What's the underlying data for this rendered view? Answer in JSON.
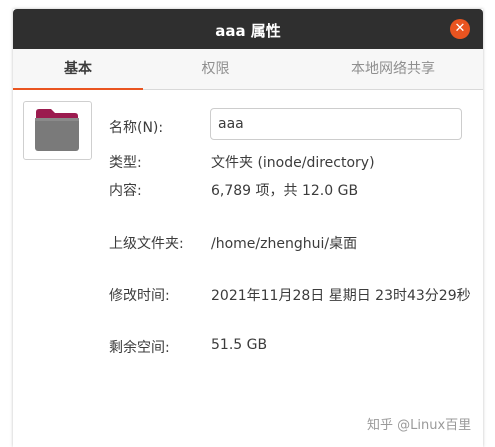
{
  "window": {
    "title": "aaa 属性"
  },
  "tabs": [
    {
      "label": "基本",
      "active": true
    },
    {
      "label": "权限",
      "active": false
    },
    {
      "label": "本地网络共享",
      "active": false
    }
  ],
  "basic": {
    "name_label": "名称(N):",
    "name_value": "aaa",
    "type_label": "类型:",
    "type_value": "文件夹 (inode/directory)",
    "contents_label": "内容:",
    "contents_value": "6,789 项，共 12.0 GB",
    "parent_label": "上级文件夹:",
    "parent_value": "/home/zhenghui/桌面",
    "modified_label": "修改时间:",
    "modified_value": "2021年11月28日 星期日 23时43分29秒",
    "free_space_label": "剩余空间:",
    "free_space_value": "51.5 GB"
  },
  "watermark": "知乎 @Linux百里",
  "icons": {
    "close": "close-icon",
    "folder": "folder-icon"
  },
  "colors": {
    "accent": "#e95420",
    "titlebar": "#2f2f2f",
    "folder_body": "#7a7a7a",
    "folder_tab": "#9b1b4f"
  }
}
